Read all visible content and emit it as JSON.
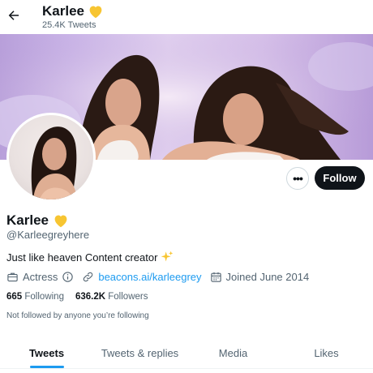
{
  "header": {
    "title": "Karlee",
    "tweet_count": "25.4K Tweets"
  },
  "icons": {
    "back": "back-arrow-icon",
    "heart": "yellow-heart-icon",
    "more": "more-icon",
    "briefcase": "briefcase-icon",
    "info": "info-icon",
    "link": "link-icon",
    "calendar": "calendar-icon",
    "sparkles": "sparkles-icon"
  },
  "colors": {
    "accent": "#1d9bf0",
    "follow_bg": "#0f1419",
    "heart": "#f7c532",
    "sparkle": "#f7c532"
  },
  "actions": {
    "more_label": "•••",
    "follow_label": "Follow"
  },
  "profile": {
    "name": "Karlee",
    "handle": "@Karleegreyhere",
    "bio": "Just like heaven Content creator",
    "category": "Actress",
    "link": "beacons.ai/karleegrey",
    "joined": "Joined June 2014",
    "following_count": "665",
    "following_label": "Following",
    "followers_count": "636.2K",
    "followers_label": "Followers",
    "followed_note": "Not followed by anyone you’re following"
  },
  "tabs": [
    {
      "label": "Tweets",
      "active": true
    },
    {
      "label": "Tweets & replies",
      "active": false
    },
    {
      "label": "Media",
      "active": false
    },
    {
      "label": "Likes",
      "active": false
    }
  ]
}
